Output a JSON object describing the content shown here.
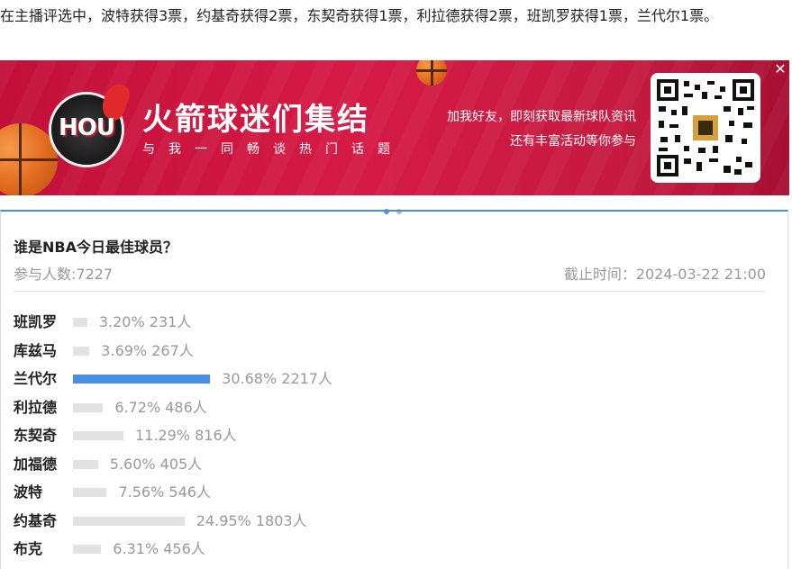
{
  "headline": "在主播评选中，波特获得3票，约基奇获得2票，东契奇获得1票，利拉德获得2票，班凯罗获得1票，兰代尔1票。",
  "banner": {
    "logo_text": "HOU",
    "title": "火箭球迷们集结",
    "subtitle": "与我一同畅谈热门话题",
    "right_line1": "加我好友，即刻获取最新球队资讯",
    "right_line2": "还有丰富活动等你参与",
    "close_label": "✕",
    "colors": {
      "background": "#d51a45",
      "accent": "#e06a1e"
    }
  },
  "carousel": {
    "count": 2,
    "active": 0
  },
  "poll": {
    "title": "谁是NBA今日最佳球员？",
    "participants": "参与人数:7227",
    "deadline": "截止时间：2024-03-22 21:00",
    "accent_color": "#4a90e2",
    "options": [
      {
        "name": "班凯罗",
        "percent": 3.2,
        "percent_text": "3.20%",
        "votes": "231人"
      },
      {
        "name": "库兹马",
        "percent": 3.69,
        "percent_text": "3.69%",
        "votes": "267人"
      },
      {
        "name": "兰代尔",
        "percent": 30.68,
        "percent_text": "30.68%",
        "votes": "2217人",
        "leading": true
      },
      {
        "name": "利拉德",
        "percent": 6.72,
        "percent_text": "6.72%",
        "votes": "486人"
      },
      {
        "name": "东契奇",
        "percent": 11.29,
        "percent_text": "11.29%",
        "votes": "816人"
      },
      {
        "name": "加福德",
        "percent": 5.6,
        "percent_text": "5.60%",
        "votes": "405人"
      },
      {
        "name": "波特",
        "percent": 7.56,
        "percent_text": "7.56%",
        "votes": "546人"
      },
      {
        "name": "约基奇",
        "percent": 24.95,
        "percent_text": "24.95%",
        "votes": "1803人"
      },
      {
        "name": "布克",
        "percent": 6.31,
        "percent_text": "6.31%",
        "votes": "456人"
      }
    ]
  }
}
